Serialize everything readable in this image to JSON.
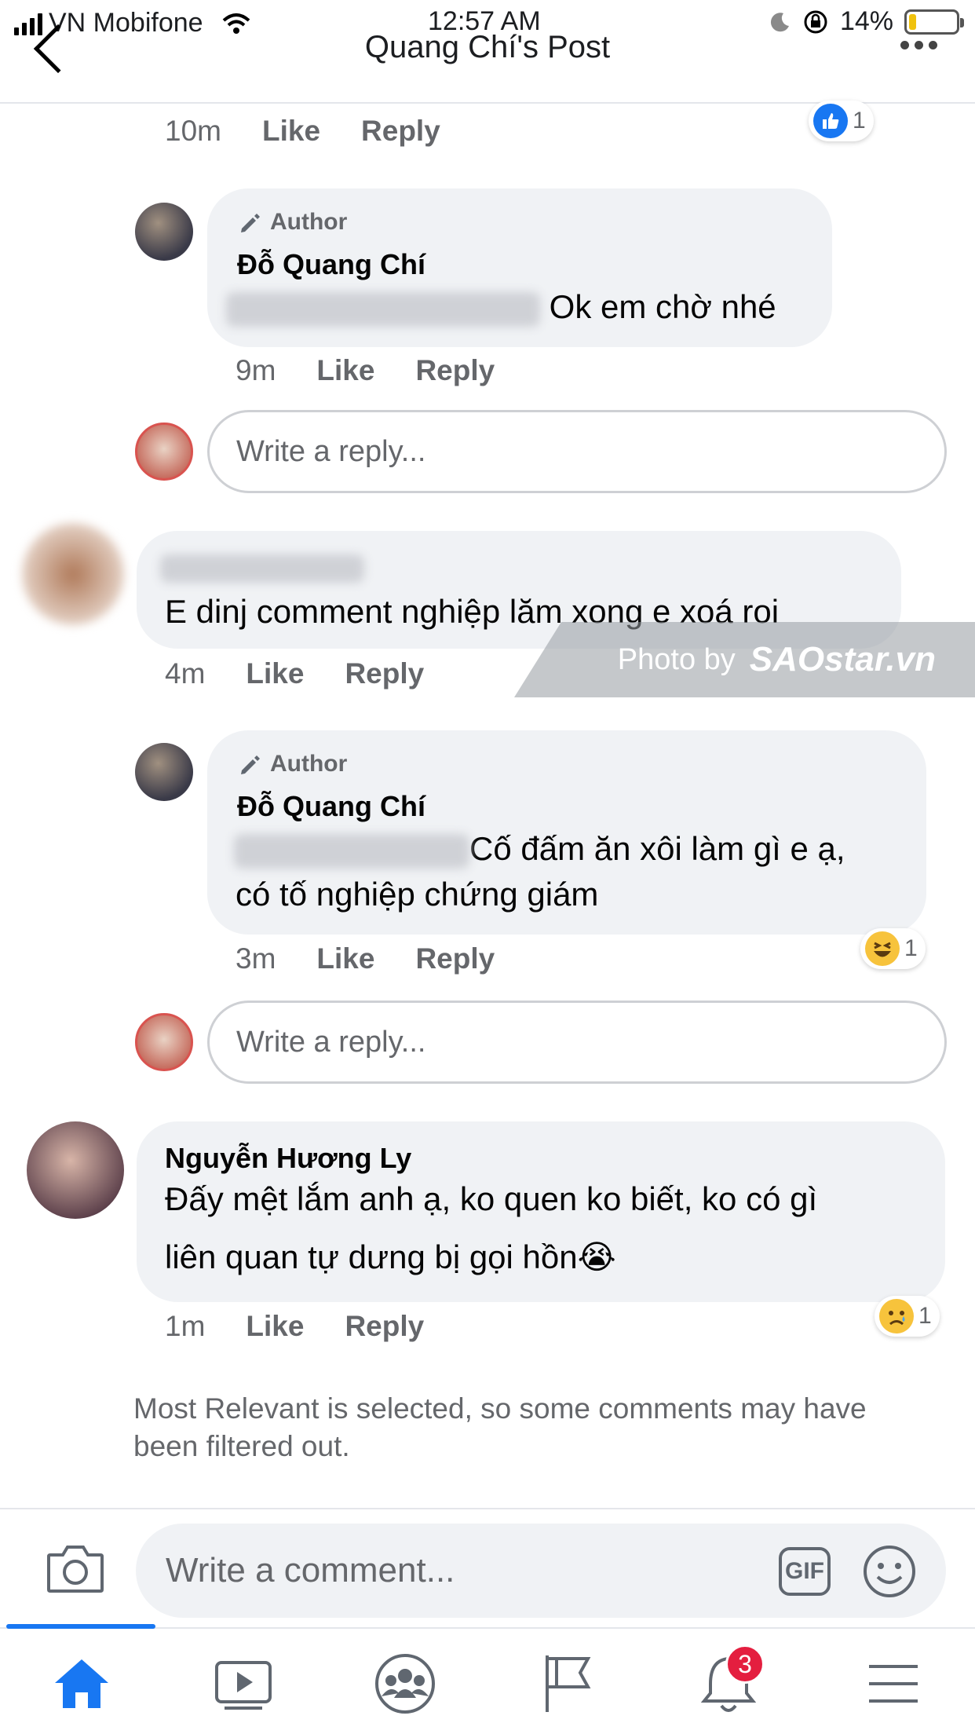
{
  "status_bar": {
    "carrier": "VN Mobifone",
    "time": "12:57 AM",
    "battery": "14%",
    "battery_level": 0.14
  },
  "header": {
    "title": "Quang Chí's Post"
  },
  "comments": [
    {
      "meta": {
        "time": "10m",
        "like": "Like",
        "reply": "Reply"
      },
      "reaction": {
        "type": "like",
        "count": "1"
      }
    },
    {
      "author_tag": "Author",
      "name": "Đỗ Quang Chí",
      "text": "Ok em chờ nhé",
      "meta": {
        "time": "9m",
        "like": "Like",
        "reply": "Reply"
      }
    },
    {
      "text": "E dinj comment nghiệp lăm xong e xoá roi",
      "meta": {
        "time": "4m",
        "like": "Like",
        "reply": "Reply"
      }
    },
    {
      "author_tag": "Author",
      "name": "Đỗ Quang Chí",
      "text_line1": "Cố đấm ăn xôi làm gì e ạ,",
      "text_line2": "có tố nghiệp chứng giám",
      "meta": {
        "time": "3m",
        "like": "Like",
        "reply": "Reply"
      },
      "reaction": {
        "type": "haha",
        "count": "1"
      }
    },
    {
      "name": "Nguyễn Hương Ly",
      "text_line1": "Đấy mệt lắm anh ạ, ko quen ko biết, ko có gì",
      "text_line2": "liên quan tự dưng bị gọi hồn😭",
      "meta": {
        "time": "1m",
        "like": "Like",
        "reply": "Reply"
      },
      "reaction": {
        "type": "sad",
        "count": "1"
      }
    }
  ],
  "reply_input": {
    "placeholder": "Write a reply..."
  },
  "watermark": {
    "label": "Photo by",
    "brand": "SAOstar.vn"
  },
  "filter_note": "Most Relevant is selected, so some comments may have been filtered out.",
  "composer": {
    "placeholder": "Write a comment...",
    "gif_label": "GIF"
  },
  "tabbar": {
    "notifications_badge": "3"
  },
  "colors": {
    "accent": "#1877f2",
    "bubble": "#f0f2f5",
    "badge": "#e41e3f"
  }
}
